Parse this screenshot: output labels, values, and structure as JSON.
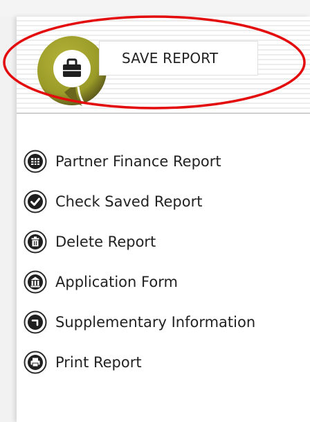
{
  "header": {
    "button_label": "SAVE REPORT",
    "logo_icon": "briefcase-icon",
    "logo_color": "#9a9a28"
  },
  "menu": {
    "items": [
      {
        "label": "Partner Finance Report",
        "icon": "grid-icon"
      },
      {
        "label": "Check Saved Report",
        "icon": "checkmark-icon"
      },
      {
        "label": "Delete Report",
        "icon": "trash-icon"
      },
      {
        "label": "Application Form",
        "icon": "building-icon"
      },
      {
        "label": "Supplementary Information",
        "icon": "corner-arrow-icon"
      },
      {
        "label": "Print Report",
        "icon": "printer-icon"
      }
    ]
  },
  "annotation": {
    "color": "#e30b0b"
  }
}
